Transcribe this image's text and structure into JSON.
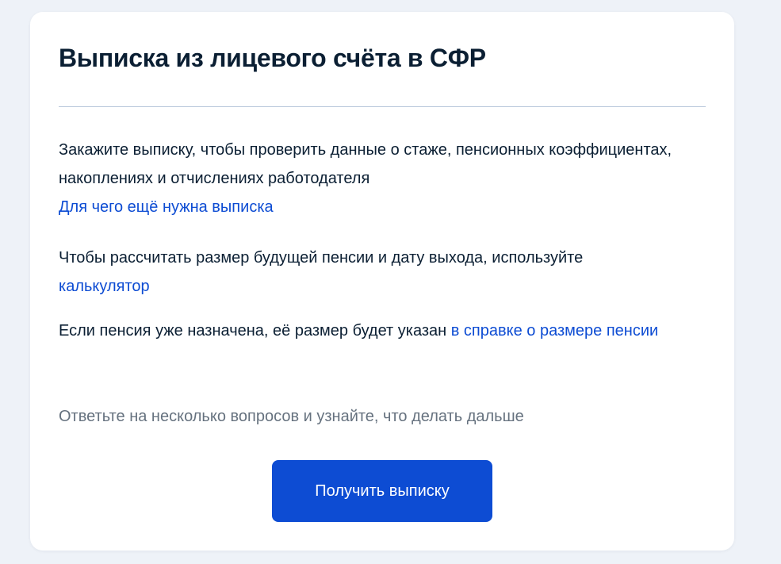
{
  "card": {
    "title": "Выписка из лицевого счёта в СФР",
    "paragraph1": {
      "text": "Закажите выписку, чтобы проверить данные о стаже, пенсионных коэффициентах, накоплениях и отчислениях работодателя",
      "link": "Для чего ещё нужна выписка"
    },
    "paragraph2": {
      "text": "Чтобы рассчитать размер будущей пенсии и дату выхода, используйте ",
      "link": "калькулятор"
    },
    "paragraph3": {
      "text": "Если пенсия уже назначена, её размер будет указан ",
      "link": "в справке о размере пенсии"
    },
    "hint": "Ответьте на несколько вопросов и узнайте, что делать дальше",
    "button_label": "Получить выписку"
  },
  "colors": {
    "background": "#eef2f8",
    "card": "#ffffff",
    "text": "#0b1f33",
    "link": "#0d4cd3",
    "hint": "#66727f",
    "button": "#0d4cd3",
    "divider": "#b9c8db"
  }
}
